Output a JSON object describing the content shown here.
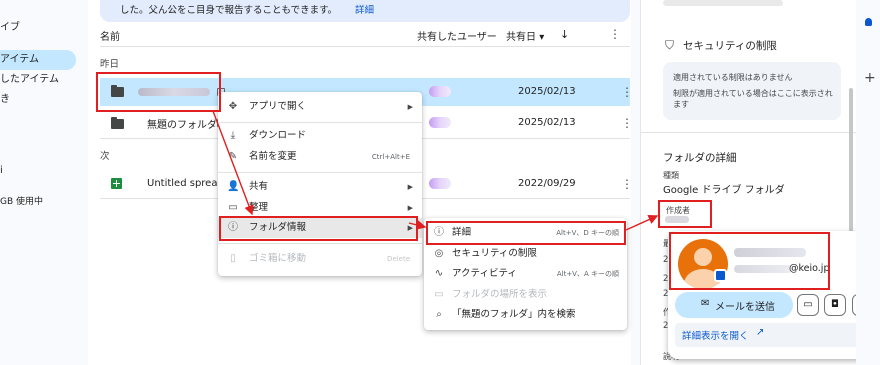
{
  "left_nav": {
    "items": [
      {
        "label": "イブ"
      },
      {
        "label": "アイテム"
      },
      {
        "label": "したアイテム"
      },
      {
        "label": "き"
      },
      {
        "label": "i"
      },
      {
        "label": "GB 使用中"
      }
    ]
  },
  "banner": {
    "text": "した。父ん公をこ目身で報告することもできます。",
    "link": "詳細"
  },
  "list": {
    "headers": {
      "name": "名前",
      "owner": "共有したユーザー",
      "date": "共有日",
      "sort_arrow": "▾"
    },
    "sections": {
      "yesterday": "昨日",
      "next": "次"
    },
    "rows": [
      {
        "name": "",
        "date": "2025/02/13"
      },
      {
        "name": "無題のフォルダ",
        "date": "2025/02/13"
      },
      {
        "name": "Untitled spreadshee",
        "date": "2022/09/29"
      }
    ]
  },
  "context_menu": {
    "items": [
      {
        "icon": "move-icon",
        "glyph": "✥",
        "label": "アプリで開く",
        "submenu": true
      },
      {
        "icon": "download-icon",
        "glyph": "⤓",
        "label": "ダウンロード"
      },
      {
        "icon": "rename-icon",
        "glyph": "✎",
        "label": "名前を変更",
        "shortcut": "Ctrl+Alt+E"
      },
      {
        "icon": "share-icon",
        "glyph": "⁺",
        "label": "共有",
        "submenu": true
      },
      {
        "icon": "organize-icon",
        "glyph": "▭",
        "label": "整理",
        "submenu": true
      },
      {
        "icon": "info-icon",
        "glyph": "ⓘ",
        "label": "フォルダ情報",
        "submenu": true
      },
      {
        "icon": "trash-icon",
        "glyph": "🗑",
        "label": "ゴミ箱に移動",
        "shortcut": "Delete",
        "disabled": true
      }
    ]
  },
  "sub_menu": {
    "items": [
      {
        "icon": "info-icon",
        "glyph": "ⓘ",
        "label": "詳細",
        "shortcut": "Alt+V、D キーの順"
      },
      {
        "icon": "security-icon",
        "glyph": "◎",
        "label": "セキュリティの制限"
      },
      {
        "icon": "activity-icon",
        "glyph": "∿",
        "label": "アクティビティ",
        "shortcut": "Alt+V、A キーの順"
      },
      {
        "icon": "folder-icon",
        "glyph": "▭",
        "label": "フォルダの場所を表示",
        "disabled": true
      },
      {
        "icon": "search-icon",
        "glyph": "⌕",
        "label": "「無題のフォルダ」内を検索"
      }
    ]
  },
  "right_panel": {
    "security_title": "セキュリティの制限",
    "restrict_line1": "適用されている制限はありません",
    "restrict_line2": "制限が適用されている場合はここに表示されます",
    "details_title": "フォルダの詳細",
    "type_label": "種類",
    "type_value": "Google ドライブ フォルダ",
    "creator_label": "作成者",
    "side_chars": [
      "最",
      "2",
      "2",
      "2",
      "作",
      "2"
    ],
    "desc_label": "説明"
  },
  "profile_popup": {
    "email_suffix": "@keio.jp",
    "send_mail": "メールを送信",
    "open_details": "詳細表示を開く"
  },
  "colors": {
    "accent": "#0b57d0",
    "selected": "#c2e7ff",
    "highlight_red": "#e02020",
    "avatar": "#e8710a"
  }
}
